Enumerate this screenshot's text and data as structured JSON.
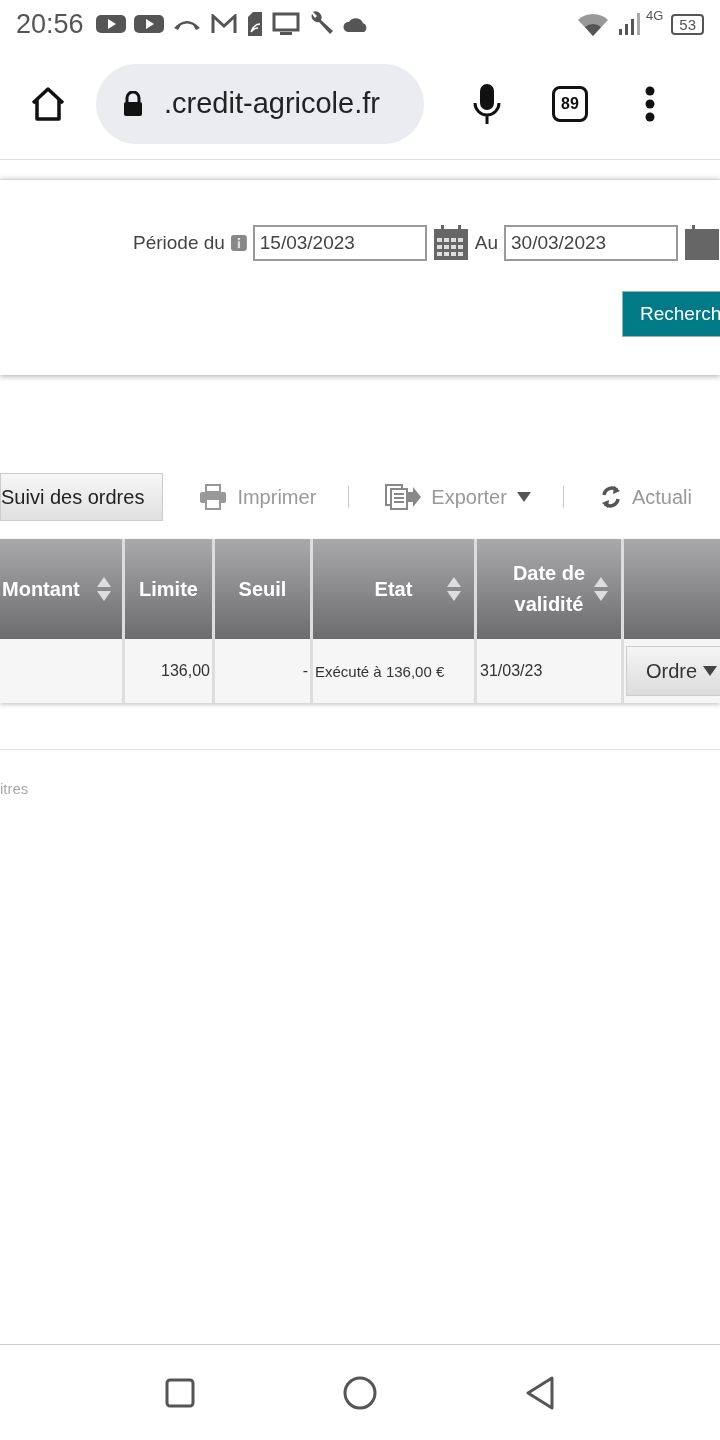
{
  "status_bar": {
    "time": "20:56",
    "network": "4G",
    "battery": "53"
  },
  "browser": {
    "url": ".credit-agricole.fr",
    "tab_count": "89"
  },
  "filter": {
    "from_label": "Période du",
    "from_value": "15/03/2023",
    "to_label": "Au",
    "to_value": "30/03/2023",
    "search_button": "Recherch"
  },
  "toolbar": {
    "tab": {
      "label": "Suivi des ordres",
      "selected": true
    },
    "actions": [
      {
        "kind": "print",
        "label": "Imprimer"
      },
      {
        "kind": "export",
        "label": "Exporter"
      },
      {
        "kind": "refresh",
        "label": "Actuali"
      }
    ]
  },
  "table": {
    "columns": [
      {
        "label": "Montant",
        "sortable": true
      },
      {
        "label": "Limite",
        "sortable": false
      },
      {
        "label": "Seuil",
        "sortable": false
      },
      {
        "label": "Etat",
        "sortable": true
      },
      {
        "label": "Date de validité",
        "sortable": true
      }
    ],
    "rows": [
      {
        "cells": [
          null,
          "136,00",
          "-",
          "Exécuté à 136,00 €",
          "31/03/23"
        ],
        "action": "Ordre"
      }
    ]
  },
  "footer_text": "itres"
}
